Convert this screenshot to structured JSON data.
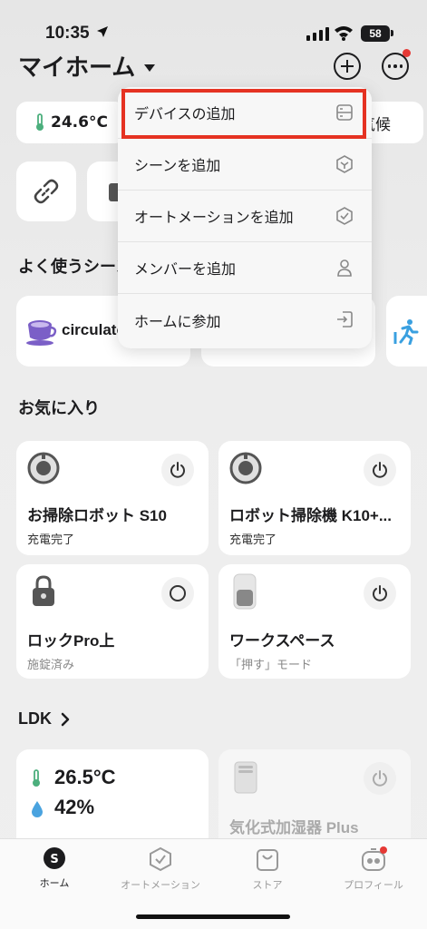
{
  "status_bar": {
    "time": "10:35",
    "battery": "58"
  },
  "header": {
    "title": "マイホーム"
  },
  "weather": {
    "temperature": "24.6°C",
    "right_label": "気候"
  },
  "menu": {
    "items": [
      {
        "label": "デバイスの追加"
      },
      {
        "label": "シーンを追加"
      },
      {
        "label": "オートメーションを追加"
      },
      {
        "label": "メンバーを追加"
      },
      {
        "label": "ホームに参加"
      }
    ]
  },
  "scenes": {
    "title": "よく使うシーン",
    "first_label": "circulator"
  },
  "favorites": {
    "title": "お気に入り",
    "devices": [
      {
        "name": "お掃除ロボット S10",
        "status": "充電完了"
      },
      {
        "name": "ロボット掃除機 K10+...",
        "status": "充電完了"
      },
      {
        "name": "ロックPro上",
        "status": "施錠済み"
      },
      {
        "name": "ワークスペース",
        "status": "「押す」モード"
      }
    ]
  },
  "room": {
    "title": "LDK",
    "temperature": "26.5°C",
    "humidity": "42%",
    "humidifier": "気化式加湿器 Plus"
  },
  "tabbar": {
    "tabs": [
      {
        "label": "ホーム"
      },
      {
        "label": "オートメーション"
      },
      {
        "label": "ストア"
      },
      {
        "label": "プロフィール"
      }
    ]
  },
  "colors": {
    "accent_red": "#e53222",
    "thermo_green": "#4caf7d",
    "humidity_blue": "#4aa3df"
  }
}
